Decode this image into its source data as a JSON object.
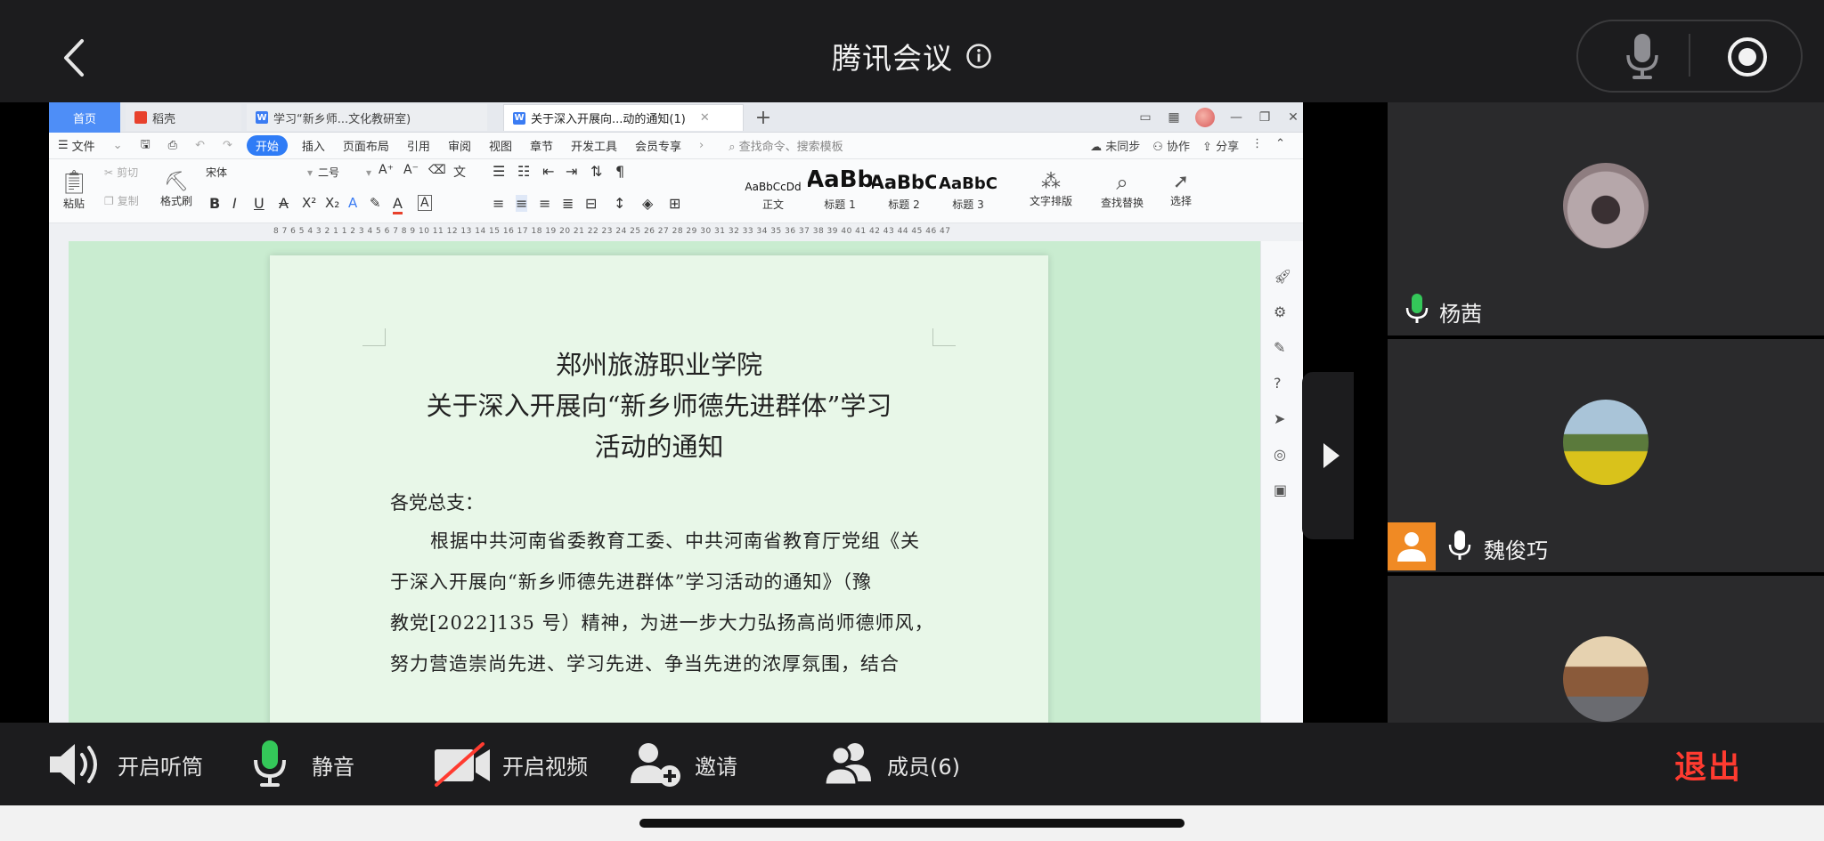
{
  "meeting": {
    "title": "腾讯会议"
  },
  "wps": {
    "tabs": [
      {
        "label": "首页"
      },
      {
        "label": "稻壳"
      },
      {
        "label": "学习“新乡师...文化教研室)"
      },
      {
        "label": "关于深入开展向...动的通知(1)"
      }
    ],
    "menu": {
      "file": "文件",
      "items": [
        "开始",
        "插入",
        "页面布局",
        "引用",
        "审阅",
        "视图",
        "章节",
        "开发工具",
        "会员专享"
      ],
      "search_placeholder": "查找命令、搜索模板",
      "unsynced": "未同步",
      "collab": "协作",
      "share": "分享"
    },
    "ribbon": {
      "paste": "粘贴",
      "cut": "剪切",
      "copy": "复制",
      "format_painter": "格式刷",
      "font_name": "宋体",
      "font_size": "二号",
      "styles": [
        {
          "sample": "AaBbCcDd",
          "name": "正文"
        },
        {
          "sample": "AaBb",
          "name": "标题 1"
        },
        {
          "sample": "AaBbC",
          "name": "标题 2"
        },
        {
          "sample": "AaBbC",
          "name": "标题 3"
        }
      ],
      "text_layout": "文字排版",
      "find_replace": "查找替换",
      "select": "选择"
    },
    "ruler_text": "8 7 6 5 4 3 2 1    1 2 3 4 5 6 7 8 9 10 11 12 13 14 15 16 17 18 19 20 21 22 23 24 25 26 27 28 29 30 31 32 33 34 35 36 37 38 39 40 41 42 43 44 45 46 47"
  },
  "document": {
    "title_1": "郑州旅游职业学院",
    "title_2": "关于深入开展向“新乡师德先进群体”学习",
    "title_3": "活动的通知",
    "salutation": "各党总支：",
    "para_1": "根据中共河南省委教育工委、中共河南省教育厅党组《关",
    "para_2": "于深入开展向“新乡师德先进群体”学习活动的通知》（豫",
    "para_3": "教党[2022]135 号）精神，为进一步大力弘扬高尚师德师风，",
    "para_4": "努力营造崇尚先进、学习先进、争当先进的浓厚氛围，结合"
  },
  "participants": [
    {
      "name": "杨茜",
      "mic": "active"
    },
    {
      "name": "魏俊巧",
      "mic": "idle",
      "host": true
    },
    {
      "name": "",
      "mic": "none"
    }
  ],
  "controls": {
    "speaker": "开启听筒",
    "mute": "静音",
    "video": "开启视频",
    "invite": "邀请",
    "members": "成员(6)",
    "exit": "退出"
  },
  "colors": {
    "exit": "#ff3b30",
    "mic_active": "#34c759",
    "host_badge": "#f08a24",
    "wps_accent": "#2f7cf6"
  }
}
